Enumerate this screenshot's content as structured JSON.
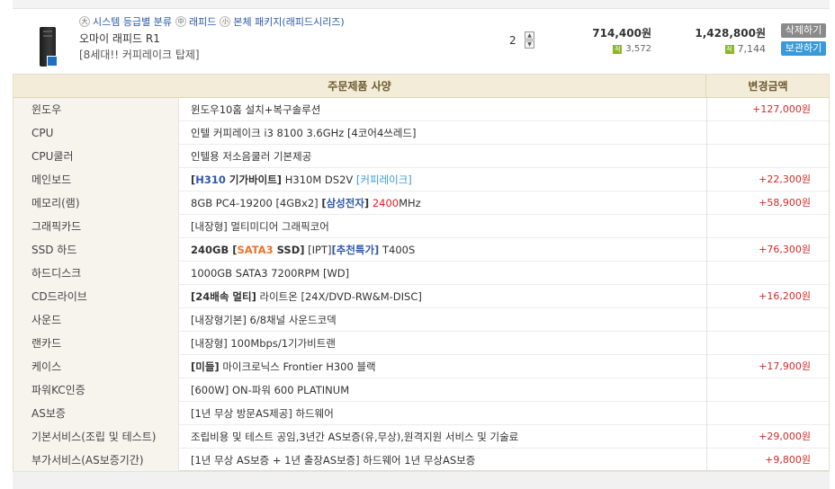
{
  "product": {
    "categories": [
      "시스템 등급별 분류",
      "래피드",
      "본체 패키지(래피드시리즈)"
    ],
    "category_icons": [
      "大",
      "中",
      "小"
    ],
    "name": "오마이 래피드 R1",
    "description": "[8세대!! 커피레이크 탑제]",
    "quantity": "2",
    "unit_price": "714,400원",
    "unit_points": "3,572",
    "total_price": "1,428,800원",
    "total_points": "7,144",
    "points_icon": "적",
    "delete_label": "삭제하기",
    "keep_label": "보관하기"
  },
  "spec_table": {
    "header_spec": "주문제품 사양",
    "header_change": "변경금액",
    "rows": [
      {
        "label": "윈도우",
        "value": "윈도우10홈 설치+복구솔루션",
        "change": "+127,000원"
      },
      {
        "label": "CPU",
        "value": "인텔 커피레이크 i3 8100 3.6GHz [4코어4쓰레드]",
        "change": ""
      },
      {
        "label": "CPU쿨러",
        "value": "인텔용 저소음쿨러 기본제공",
        "change": ""
      },
      {
        "label": "메인보드",
        "value_parts": [
          "[",
          "H310",
          " 기가바이트]",
          " H310M DS2V ",
          "[커피레이크]"
        ],
        "change": "+22,300원"
      },
      {
        "label": "메모리(램)",
        "value_parts": [
          "8GB PC4-19200 [4GBx2] ",
          "[",
          "삼성전자",
          "]",
          " ",
          "2400",
          "MHz"
        ],
        "change": "+58,900원"
      },
      {
        "label": "그래픽카드",
        "value": "[내장형] 멀티미디어 그래픽코어",
        "change": ""
      },
      {
        "label": "SSD 하드",
        "value_parts": [
          "240GB [",
          "SATA3",
          " SSD]",
          " [IPT]",
          "[추천특가]",
          " T400S"
        ],
        "change": "+76,300원"
      },
      {
        "label": "하드디스크",
        "value": "1000GB SATA3 7200RPM [WD]",
        "change": ""
      },
      {
        "label": "CD드라이브",
        "value_parts": [
          "[24배속 멀티]",
          " 라이트온 [24X/DVD-RW&M-DISC]"
        ],
        "change": "+16,200원"
      },
      {
        "label": "사운드",
        "value": "[내장형기본] 6/8채널 사운드코덱",
        "change": ""
      },
      {
        "label": "랜카드",
        "value": "[내장형] 100Mbps/1기가비트랜",
        "change": ""
      },
      {
        "label": "케이스",
        "value_parts": [
          "[미들]",
          " 마이크로닉스 Frontier H300 블랙"
        ],
        "change": "+17,900원"
      },
      {
        "label": "파워KC인증",
        "value": "[600W] ON-파워 600 PLATINUM",
        "change": ""
      },
      {
        "label": "AS보증",
        "value": "[1년 무상 방문AS제공] 하드웨어",
        "change": ""
      },
      {
        "label": "기본서비스(조립 및 테스트)",
        "value": "조립비용 및 테스트 공임,3년간 AS보증(유,무상),원격지원 서비스 및 기술료",
        "change": "+29,000원"
      },
      {
        "label": "부가서비스(AS보증기간)",
        "value": "[1년 무상 AS보증 + 1년 출장AS보증] 하드웨어 1년 무상AS보증",
        "change": "+9,800원"
      }
    ]
  }
}
